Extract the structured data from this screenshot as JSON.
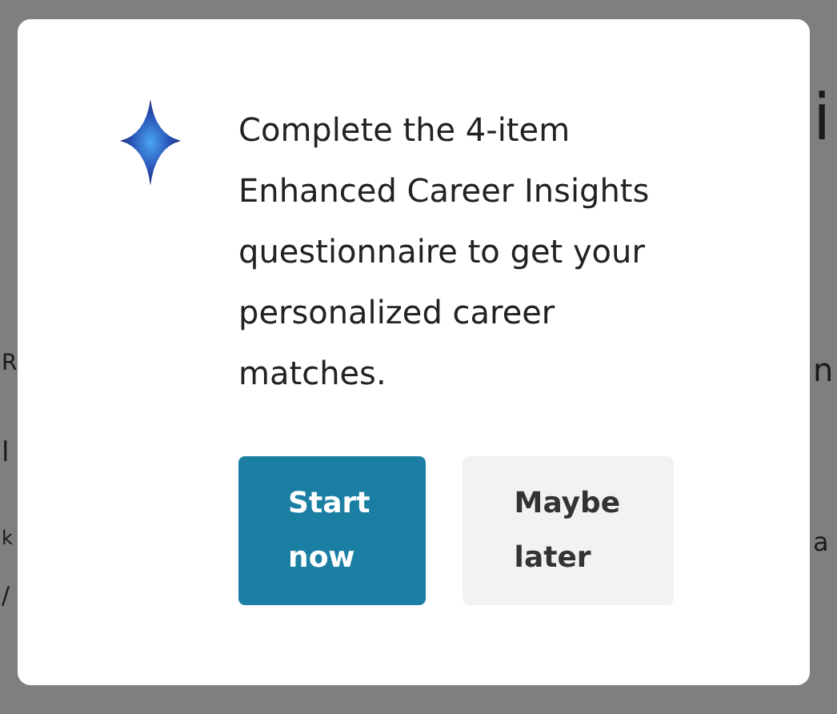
{
  "background": {
    "left_fragments": [
      "R",
      "l",
      "k",
      "/"
    ],
    "right_fragments": [
      "i",
      "n",
      "a"
    ]
  },
  "dialog": {
    "message": "Complete the 4-item Enhanced Career Insights questionnaire to get your personalized career matches.",
    "buttons": [
      {
        "label": "Start now",
        "kind": "primary"
      },
      {
        "label": "Maybe later",
        "kind": "secondary"
      }
    ]
  }
}
